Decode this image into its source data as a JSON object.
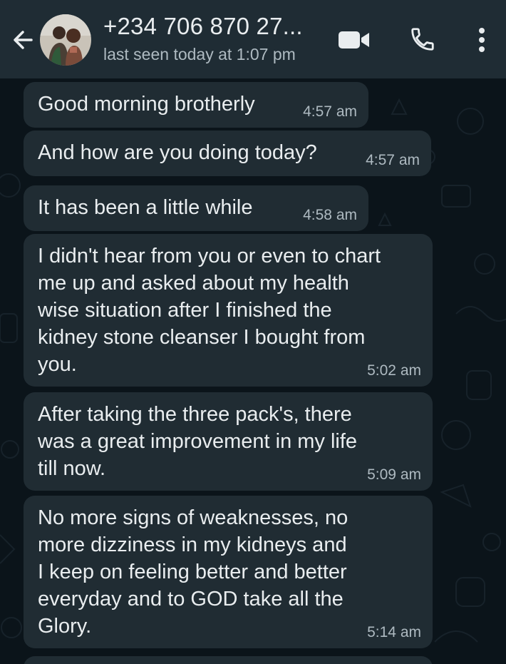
{
  "header": {
    "contact_name": "+234 706 870 27...",
    "last_seen": "last seen today at 1:07 pm",
    "icons": [
      "back-arrow-icon",
      "video-call-icon",
      "voice-call-icon",
      "more-options-icon"
    ]
  },
  "messages": [
    {
      "text": "Good morning brotherly",
      "time": "4:57 am"
    },
    {
      "text": "And how are you doing today?",
      "time": "4:57 am"
    },
    {
      "text": "It has been a little while",
      "time": "4:58 am"
    },
    {
      "lines": [
        "I didn't hear from you or even to chart",
        "me up and asked about my health",
        "wise situation after I finished the",
        "kidney stone cleanser I bought from",
        "you."
      ],
      "time": "5:02 am"
    },
    {
      "lines": [
        "After taking the three pack's, there",
        "was a great improvement in my life",
        "till now."
      ],
      "time": "5:09 am"
    },
    {
      "lines": [
        "No more signs of weaknesses, no",
        "more dizziness in my kidneys and",
        "I keep on feeling better and better",
        "everyday and to GOD take all the",
        "Glory."
      ],
      "time": "5:14 am"
    }
  ],
  "colors": {
    "header_bg": "#1f2c34",
    "chat_bg": "#0b141a",
    "bubble_bg": "#202c33",
    "text": "#e9edef",
    "meta": "#aebac1"
  }
}
